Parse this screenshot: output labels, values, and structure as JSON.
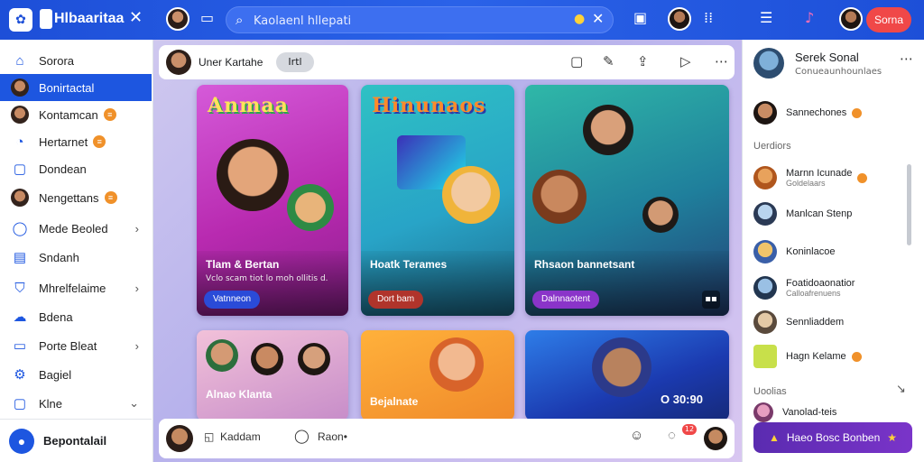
{
  "topbar": {
    "brand": "Hlbaaritaa",
    "close_glyph": "✕",
    "search_placeholder": "Kaolaenl hllepati",
    "action_button": "Sorna",
    "icons": [
      "search-icon",
      "lock-icon",
      "clear-icon",
      "card-icon",
      "image-icon",
      "apps-grid-icon",
      "menu-icon",
      "music-icon"
    ]
  },
  "sidebar": {
    "items": [
      {
        "label": "Sorora",
        "icon": "home-icon"
      },
      {
        "label": "Bonirtactal",
        "icon": "avatar"
      },
      {
        "label": "Kontamcan",
        "icon": "avatar",
        "badge": "≡"
      },
      {
        "label": "Hertarnet",
        "icon": "notification-icon",
        "badge": "≡"
      },
      {
        "label": "Dondean",
        "icon": "bookmark-icon"
      },
      {
        "label": "Nengettans",
        "icon": "avatar",
        "badge": "≡"
      },
      {
        "label": "Mede Beoled",
        "icon": "chat-icon"
      },
      {
        "label": "Sndanh",
        "icon": "doc-icon"
      },
      {
        "label": "Mhrelfelaime",
        "icon": "shield-icon"
      },
      {
        "label": "Bdena",
        "icon": "cloud-icon"
      },
      {
        "label": "Porte Bleat",
        "icon": "folder-icon"
      },
      {
        "label": "Bagiel",
        "icon": "settings-icon"
      },
      {
        "label": "Klne",
        "icon": "more-icon"
      }
    ],
    "footer_label": "Bepontalail"
  },
  "main": {
    "post_header": {
      "name": "Uner Kartahe",
      "chip": "Irtl"
    },
    "cards": [
      {
        "headline": "Anmaa",
        "title": "Tlam & Bertan",
        "subtitle": "Vclo scam tiot lo moh ollitis d.",
        "button": "Vatnneon",
        "button_color": "#2a4bd8"
      },
      {
        "headline": "Hinunaos",
        "title": "Hoatk Terames",
        "subtitle": "",
        "button": "Dort bam",
        "button_color": "#b0342b"
      },
      {
        "headline": "",
        "title": "Rhsaon bannetsant",
        "subtitle": "",
        "button": "Dalnnaotent",
        "button_color": "#8a34c9"
      },
      {
        "headline": "",
        "title": "Alnao Klanta",
        "subtitle": "",
        "button": "",
        "button_color": ""
      },
      {
        "headline": "",
        "title": "Bejalnate",
        "subtitle": "",
        "button": "",
        "button_color": ""
      },
      {
        "headline": "",
        "title": "O 30:90",
        "subtitle": "",
        "button": "",
        "button_color": ""
      }
    ],
    "bottom_bar": {
      "item1": "Kaddam",
      "item2": "Raon•",
      "badge": "12"
    }
  },
  "right_panel": {
    "profile_name": "Serek Sonal",
    "profile_sub": "Conueaunhounlaes",
    "contacts": [
      {
        "name": "Sannechones",
        "sub": ""
      },
      {
        "name": "Marnn Icunade",
        "sub": "Goldelaars"
      },
      {
        "name": "Manlcan Stenp",
        "sub": ""
      },
      {
        "name": "Koninlacoe",
        "sub": ""
      },
      {
        "name": "Foatidoaonatior",
        "sub": "Calloafrenuens"
      },
      {
        "name": "Sennliaddem",
        "sub": ""
      },
      {
        "name": "Hagn Kelame",
        "sub": ""
      },
      {
        "name": "Vanolad-teis",
        "sub": ""
      }
    ],
    "section1": "Uerdiors",
    "section2": "Uoolias",
    "cta": "Haeo Bosc Bonben"
  }
}
